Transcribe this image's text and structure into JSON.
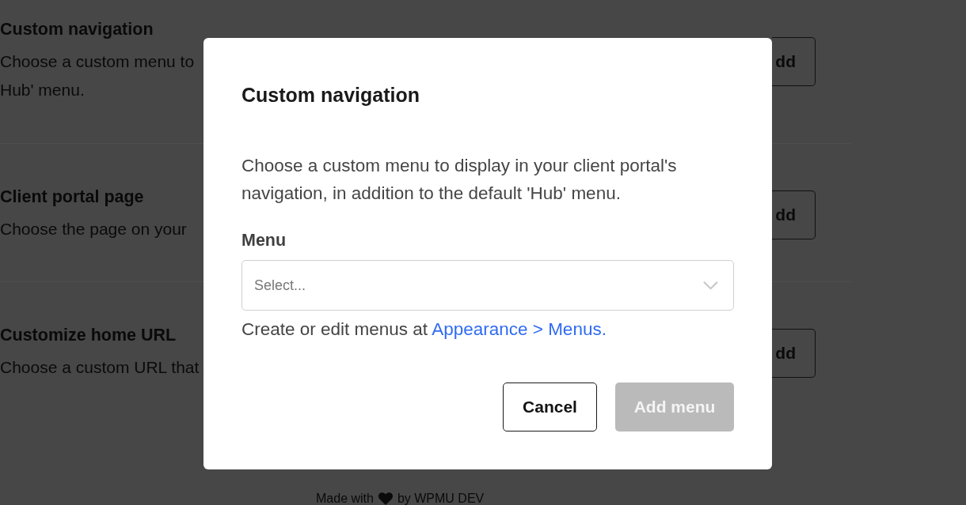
{
  "background_page": {
    "sections": [
      {
        "title": "Custom navigation",
        "description": [
          "Choose a custom menu to",
          "Hub' menu."
        ],
        "button": "dd"
      },
      {
        "title": "Client portal page",
        "description": [
          "Choose the page on your"
        ],
        "button": "dd"
      },
      {
        "title": "Customize home URL",
        "description": [
          "Choose a custom URL that"
        ],
        "button": "dd"
      }
    ],
    "footer": {
      "before": "Made with",
      "after": "by WPMU DEV"
    }
  },
  "dialog": {
    "title": "Custom navigation",
    "description": "Choose a custom menu to display in your client portal's navigation, in addition to the default 'Hub' menu.",
    "field": {
      "label": "Menu",
      "placeholder": "Select..."
    },
    "help": {
      "text": "Create or edit menus at",
      "link": "Appearance > Menus."
    },
    "buttons": [
      {
        "label": "Cancel",
        "kind": "secondary",
        "disabled": false
      },
      {
        "label": "Add menu",
        "kind": "primary",
        "disabled": true
      }
    ]
  }
}
